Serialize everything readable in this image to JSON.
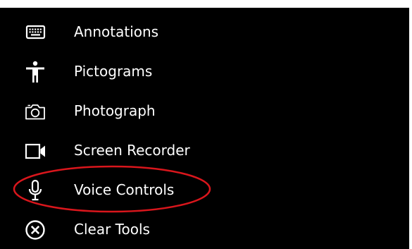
{
  "menu": {
    "items": [
      {
        "label": "Annotations",
        "icon": "keyboard-icon"
      },
      {
        "label": "Pictograms",
        "icon": "accessibility-person-icon"
      },
      {
        "label": "Photograph",
        "icon": "camera-icon"
      },
      {
        "label": "Screen Recorder",
        "icon": "video-camera-icon"
      },
      {
        "label": "Voice Controls",
        "icon": "microphone-icon"
      },
      {
        "label": "Clear Tools",
        "icon": "close-circle-icon"
      }
    ]
  },
  "colors": {
    "panel_background": "#000000",
    "text": "#ffffff",
    "highlight": "#d9161c"
  }
}
